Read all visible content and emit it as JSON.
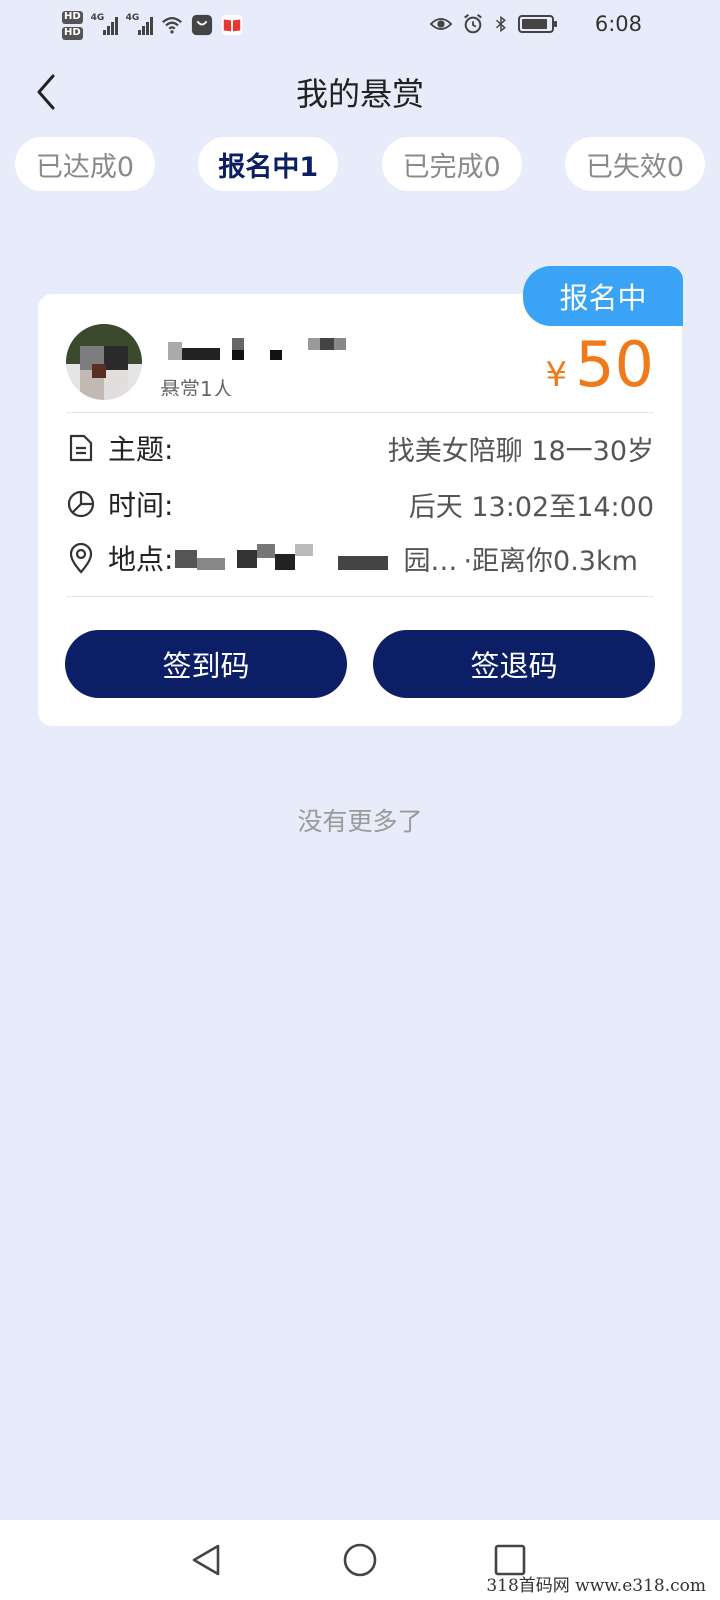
{
  "status_bar": {
    "hd_1": "HD",
    "hd_2": "HD",
    "network_1": "4G",
    "network_2": "4G",
    "time": "6:08"
  },
  "header": {
    "title": "我的悬赏"
  },
  "tabs": [
    {
      "label": "已达成0",
      "active": false
    },
    {
      "label": "报名中1",
      "active": true
    },
    {
      "label": "已完成0",
      "active": false
    },
    {
      "label": "已失效0",
      "active": false
    }
  ],
  "card": {
    "status": "报名中",
    "sub_label": "悬赏1人",
    "currency": "¥",
    "amount": "50",
    "topic_label": "主题:",
    "topic_value": "找美女陪聊 18一30岁",
    "time_label": "时间:",
    "time_value": "后天 13:02至14:00",
    "location_label": "地点:",
    "location_visible": "园…",
    "distance": "·距离你0.3km",
    "checkin_button": "签到码",
    "checkout_button": "签退码"
  },
  "footer_text": "没有更多了",
  "watermark": "318首码网  www.e318.com",
  "colors": {
    "background": "#e8ebf9",
    "primary_dark": "#0c1f66",
    "ribbon_blue": "#3aa3f5",
    "reward_orange": "#f07a1a"
  }
}
